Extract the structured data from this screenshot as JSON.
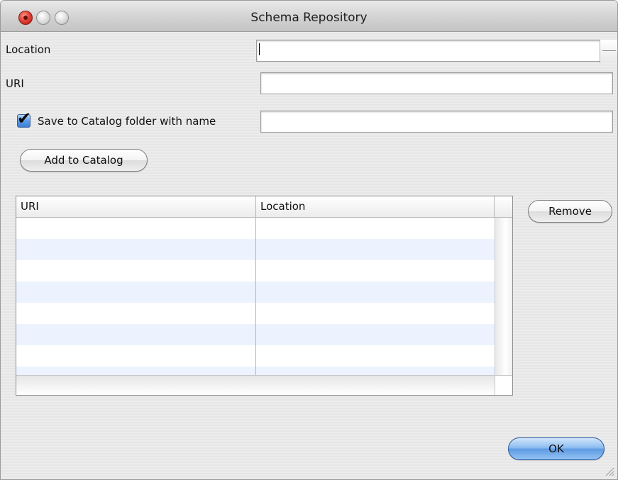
{
  "window": {
    "title": "Schema Repository"
  },
  "form": {
    "location_label": "Location",
    "location_value": "",
    "uri_label": "URI",
    "uri_value": "",
    "save_label": "Save to Catalog folder with name",
    "save_checked": true,
    "save_name_value": ""
  },
  "buttons": {
    "add_to_catalog": "Add to Catalog",
    "remove": "Remove",
    "ok": "OK"
  },
  "table": {
    "columns": [
      "URI",
      "Location",
      ""
    ],
    "rows": []
  },
  "colors": {
    "row_stripe": "#edf3fe",
    "ok_button": "#5e9be3",
    "close_button": "#e0443a"
  }
}
